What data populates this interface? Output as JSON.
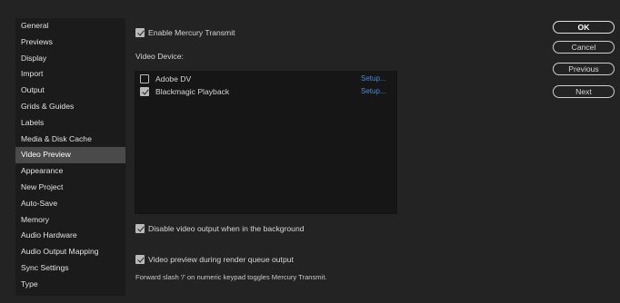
{
  "sidebar": {
    "items": [
      {
        "label": "General"
      },
      {
        "label": "Previews"
      },
      {
        "label": "Display"
      },
      {
        "label": "Import"
      },
      {
        "label": "Output"
      },
      {
        "label": "Grids & Guides"
      },
      {
        "label": "Labels"
      },
      {
        "label": "Media & Disk Cache"
      },
      {
        "label": "Video Preview"
      },
      {
        "label": "Appearance"
      },
      {
        "label": "New Project"
      },
      {
        "label": "Auto-Save"
      },
      {
        "label": "Memory"
      },
      {
        "label": "Audio Hardware"
      },
      {
        "label": "Audio Output Mapping"
      },
      {
        "label": "Sync Settings"
      },
      {
        "label": "Type"
      }
    ],
    "selected": "Video Preview"
  },
  "main": {
    "enable_mercury_transmit": {
      "label": "Enable Mercury Transmit",
      "checked": true
    },
    "video_device_label": "Video Device:",
    "devices": [
      {
        "name": "Adobe DV",
        "checked": false,
        "setup_label": "Setup..."
      },
      {
        "name": "Blackmagic Playback",
        "checked": true,
        "setup_label": "Setup..."
      }
    ],
    "disable_background": {
      "label": "Disable video output when in the background",
      "checked": true
    },
    "render_queue": {
      "label": "Video preview during render queue output",
      "checked": true
    },
    "note": "Forward slash '/' on numeric keypad toggles Mercury Transmit."
  },
  "buttons": {
    "ok": "OK",
    "cancel": "Cancel",
    "previous": "Previous",
    "next": "Next"
  },
  "colors": {
    "background": "#232323",
    "sidebar": "#1b1b1b",
    "selected": "#4a4a4a",
    "link": "#4a8bd6"
  }
}
